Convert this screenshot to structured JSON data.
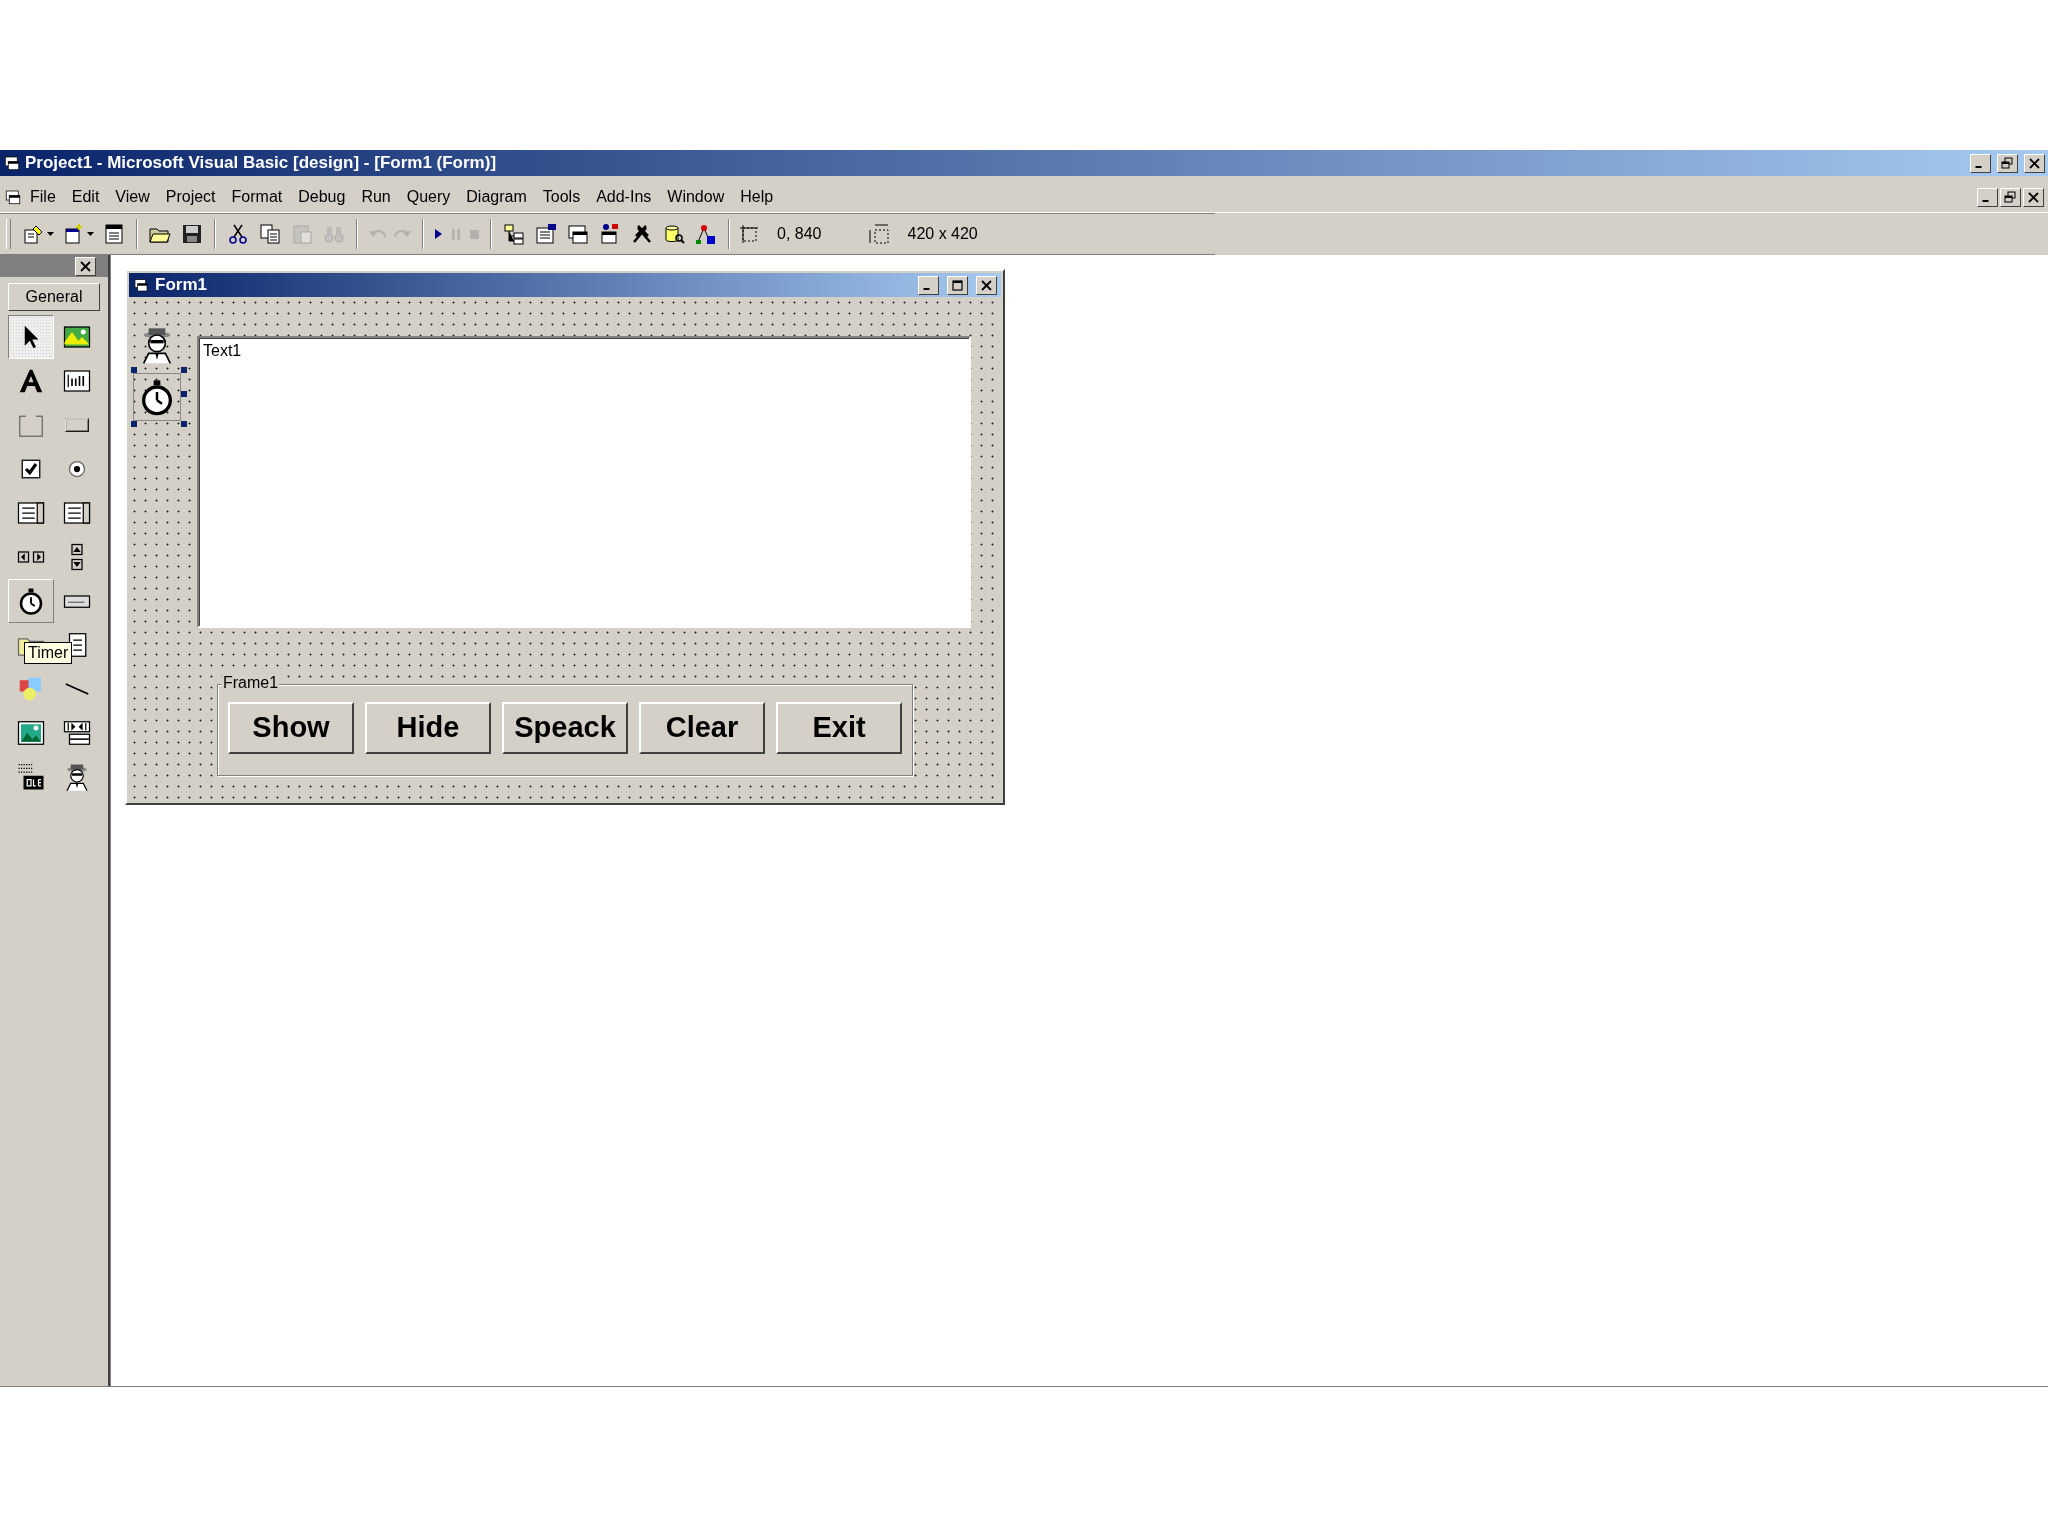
{
  "window": {
    "title": "Project1 - Microsoft Visual Basic [design] - [Form1 (Form)]"
  },
  "menu": [
    {
      "label": "File"
    },
    {
      "label": "Edit"
    },
    {
      "label": "View"
    },
    {
      "label": "Project"
    },
    {
      "label": "Format"
    },
    {
      "label": "Debug"
    },
    {
      "label": "Run"
    },
    {
      "label": "Query"
    },
    {
      "label": "Diagram"
    },
    {
      "label": "Tools"
    },
    {
      "label": "Add-Ins"
    },
    {
      "label": "Window"
    },
    {
      "label": "Help"
    }
  ],
  "toolbar": {
    "groups": [
      [
        {
          "kind": "add-project",
          "disabled": false,
          "dropdown": true
        },
        {
          "kind": "add-form",
          "disabled": false,
          "dropdown": true
        },
        {
          "kind": "menu-editor",
          "disabled": false,
          "dropdown": false
        }
      ],
      [
        {
          "kind": "folder-open",
          "disabled": false,
          "dropdown": false
        },
        {
          "kind": "floppy",
          "disabled": false,
          "dropdown": false
        }
      ],
      [
        {
          "kind": "scissors",
          "disabled": false,
          "dropdown": false
        },
        {
          "kind": "copy",
          "disabled": false,
          "dropdown": false
        },
        {
          "kind": "clipboard",
          "disabled": true,
          "dropdown": false
        },
        {
          "kind": "binoculars",
          "disabled": true,
          "dropdown": false
        }
      ],
      [
        {
          "kind": "undo",
          "disabled": true,
          "dropdown": false
        },
        {
          "kind": "redo",
          "disabled": true,
          "dropdown": false
        }
      ],
      [
        {
          "kind": "play",
          "disabled": false,
          "dropdown": false
        },
        {
          "kind": "pause",
          "disabled": true,
          "dropdown": false
        },
        {
          "kind": "stop",
          "disabled": true,
          "dropdown": false
        }
      ],
      [
        {
          "kind": "project-tree",
          "disabled": false,
          "dropdown": false
        },
        {
          "kind": "properties",
          "disabled": false,
          "dropdown": false
        },
        {
          "kind": "form-layout",
          "disabled": false,
          "dropdown": false
        },
        {
          "kind": "object-browser",
          "disabled": false,
          "dropdown": false
        },
        {
          "kind": "tools",
          "disabled": false,
          "dropdown": false
        },
        {
          "kind": "database",
          "disabled": false,
          "dropdown": false
        },
        {
          "kind": "components",
          "disabled": false,
          "dropdown": false
        }
      ]
    ],
    "position": "0, 840",
    "size": "420 x 420"
  },
  "toolbox": {
    "tab": "General",
    "tooltip": "Timer",
    "tools": [
      {
        "kind": "pointer",
        "selected": true,
        "hovered": false
      },
      {
        "kind": "picture-box",
        "selected": false,
        "hovered": false
      },
      {
        "kind": "label",
        "selected": false,
        "hovered": false
      },
      {
        "kind": "text-box",
        "selected": false,
        "hovered": false
      },
      {
        "kind": "frame",
        "selected": false,
        "hovered": false
      },
      {
        "kind": "command-button",
        "selected": false,
        "hovered": false
      },
      {
        "kind": "check-box",
        "selected": false,
        "hovered": false
      },
      {
        "kind": "option-button",
        "selected": false,
        "hovered": false
      },
      {
        "kind": "combo-box",
        "selected": false,
        "hovered": false
      },
      {
        "kind": "list-box",
        "selected": false,
        "hovered": false
      },
      {
        "kind": "hscroll",
        "selected": false,
        "hovered": false
      },
      {
        "kind": "vscroll",
        "selected": false,
        "hovered": false
      },
      {
        "kind": "timer",
        "selected": false,
        "hovered": true
      },
      {
        "kind": "drive-list",
        "selected": false,
        "hovered": false
      },
      {
        "kind": "dir-list",
        "selected": false,
        "hovered": false
      },
      {
        "kind": "file-list",
        "selected": false,
        "hovered": false
      },
      {
        "kind": "shape",
        "selected": false,
        "hovered": false
      },
      {
        "kind": "line",
        "selected": false,
        "hovered": false
      },
      {
        "kind": "image",
        "selected": false,
        "hovered": false
      },
      {
        "kind": "data",
        "selected": false,
        "hovered": false
      },
      {
        "kind": "ole",
        "selected": false,
        "hovered": false
      },
      {
        "kind": "agent",
        "selected": false,
        "hovered": false
      }
    ]
  },
  "form": {
    "title": "Form1",
    "components": [
      {
        "kind": "agent",
        "selected": false
      },
      {
        "kind": "timer",
        "selected": true
      }
    ],
    "textbox": {
      "value": "Text1"
    },
    "frame": {
      "caption": "Frame1",
      "buttons": [
        "Show",
        "Hide",
        "Speack",
        "Clear",
        "Exit"
      ]
    }
  }
}
